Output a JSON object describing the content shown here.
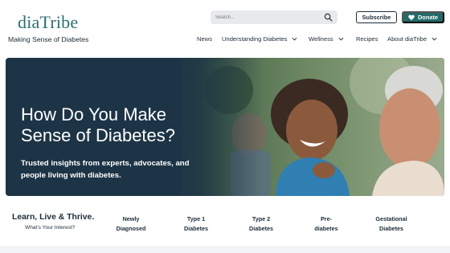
{
  "brand": {
    "logo": "diaTribe",
    "tagline": "Making Sense of Diabetes"
  },
  "search": {
    "placeholder": "Search...",
    "icon": "search-icon"
  },
  "header_buttons": {
    "subscribe": "Subscribe",
    "donate": "Donate",
    "donate_icon": "heart-icon"
  },
  "nav": {
    "items": [
      {
        "label": "News",
        "has_dropdown": false
      },
      {
        "label": "Understanding Diabetes",
        "has_dropdown": true
      },
      {
        "label": "Wellness",
        "has_dropdown": true
      },
      {
        "label": "Recipes",
        "has_dropdown": false
      },
      {
        "label": "About diaTribe",
        "has_dropdown": true
      }
    ]
  },
  "hero": {
    "title": "How Do You Make Sense of Diabetes?",
    "subtitle": "Trusted insights from experts, advocates, and people living with diabetes."
  },
  "interests": {
    "heading": "Learn, Live & Thrive.",
    "subheading": "What's Your Interest?",
    "links": [
      {
        "line1": "Newly",
        "line2": "Diagnosed"
      },
      {
        "line1": "Type 1",
        "line2": "Diabetes"
      },
      {
        "line1": "Type 2",
        "line2": "Diabetes"
      },
      {
        "line1": "Pre-",
        "line2": "diabetes"
      },
      {
        "line1": "Gestational",
        "line2": "Diabetes"
      }
    ]
  },
  "colors": {
    "brand_teal": "#2a6f73",
    "donate_bg": "#256a6b",
    "hero_bg": "#1d3446",
    "text": "#1c2b39"
  }
}
